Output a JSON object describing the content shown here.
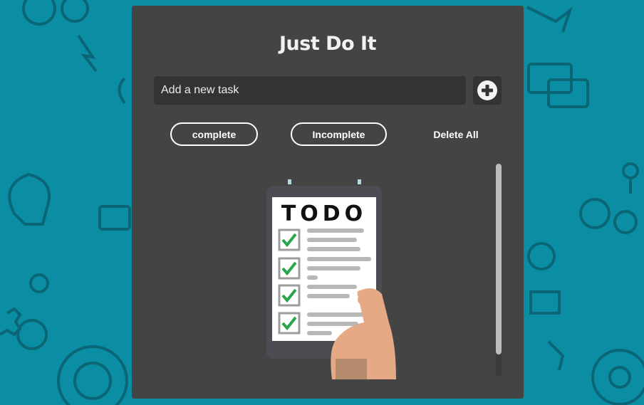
{
  "app": {
    "title": "Just Do It"
  },
  "input": {
    "placeholder": "Add a new task",
    "value": ""
  },
  "icons": {
    "add": "plus-circle-icon"
  },
  "filters": {
    "complete_label": "complete",
    "incomplete_label": "Incomplete",
    "delete_all_label": "Delete All"
  },
  "empty_state": {
    "heading": "TODO"
  },
  "colors": {
    "background": "#0b8ea3",
    "card": "#444444",
    "input_bg": "#333333",
    "text": "#f2f2f2",
    "check": "#27a64c"
  }
}
